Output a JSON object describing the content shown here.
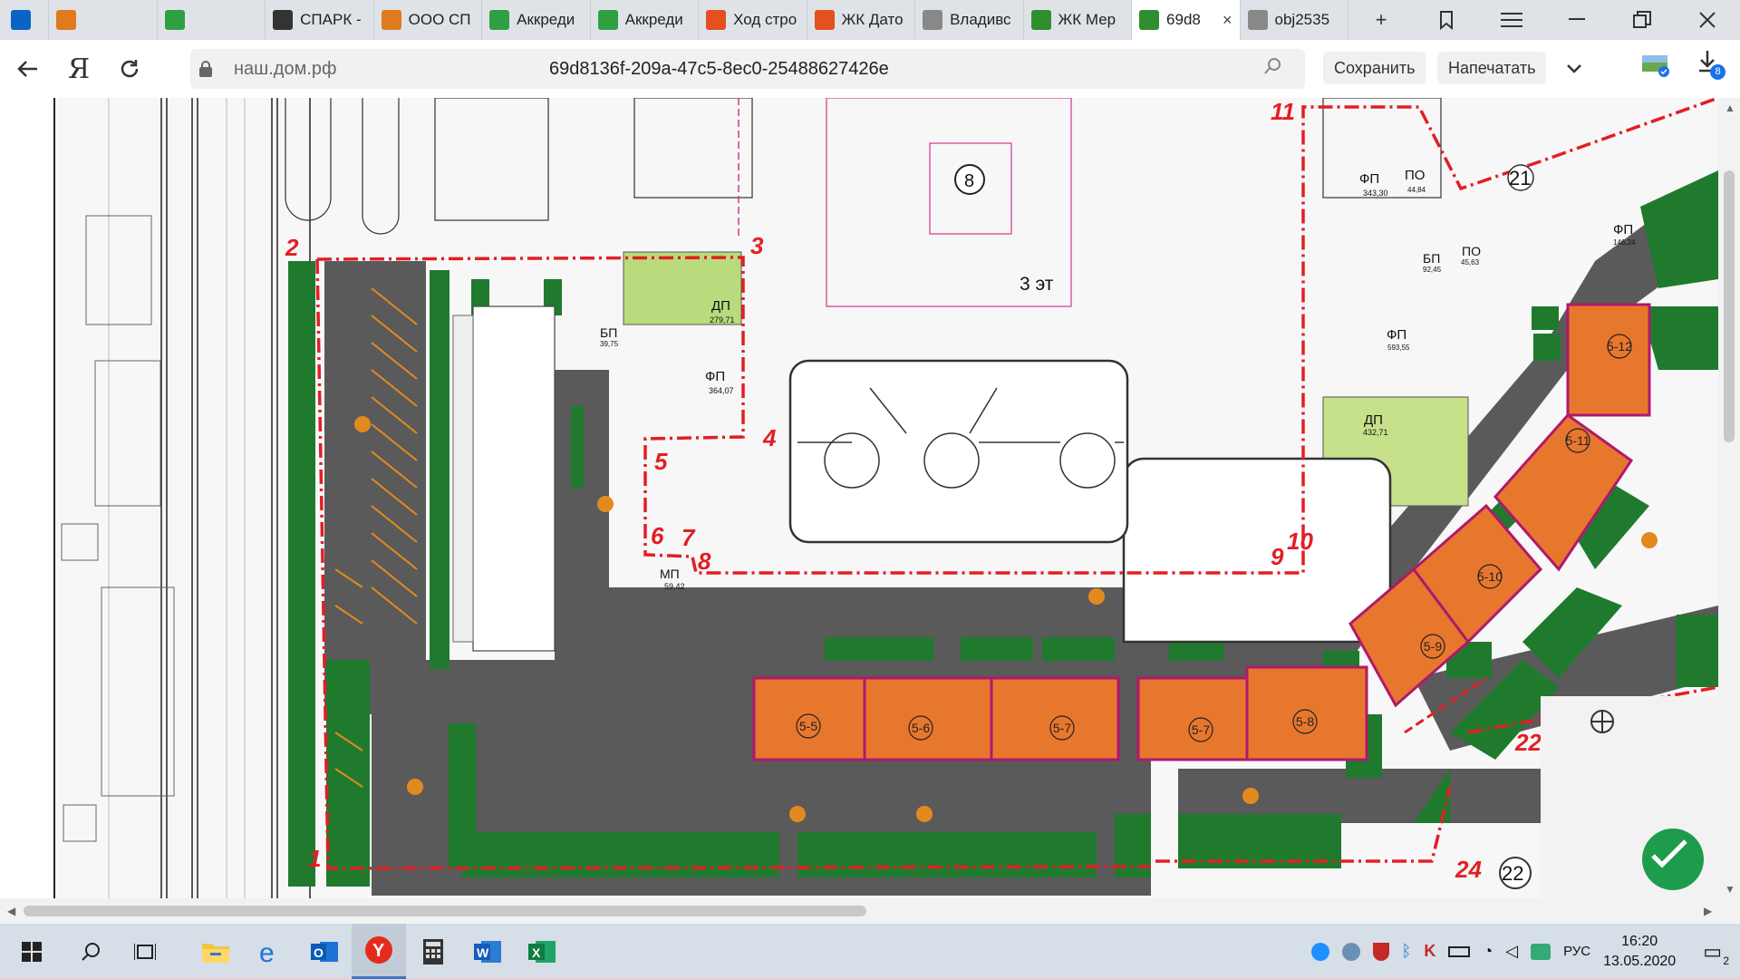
{
  "browser": {
    "tabs": [
      {
        "label": "",
        "icon": "outlook-icon",
        "color": "#0a64c6"
      },
      {
        "label": "",
        "icon": "task-icon",
        "color": "#e07a1f"
      },
      {
        "label": "",
        "icon": "green-logo-icon",
        "color": "#2ea043"
      },
      {
        "label": "СПАРК -",
        "icon": "spark-icon",
        "color": "#333333"
      },
      {
        "label": "ООО СП",
        "icon": "task-icon",
        "color": "#e07a1f"
      },
      {
        "label": "Аккреди",
        "icon": "green-logo-icon",
        "color": "#2ea043"
      },
      {
        "label": "Аккреди",
        "icon": "green-logo-icon",
        "color": "#2ea043"
      },
      {
        "label": "Ход стро",
        "icon": "swirl-icon",
        "color": "#e4501e"
      },
      {
        "label": "ЖК Дато",
        "icon": "swirl-icon",
        "color": "#e4501e"
      },
      {
        "label": "Владивс",
        "icon": "page-icon",
        "color": "#888888"
      },
      {
        "label": "ЖК Мер",
        "icon": "bars-icon",
        "color": "#2f8f2f"
      },
      {
        "label": "69d8",
        "icon": "bars-icon",
        "color": "#2f8f2f",
        "active": true
      },
      {
        "label": "obj2535",
        "icon": "page-icon",
        "color": "#888888"
      }
    ],
    "new_tab": "+",
    "address": {
      "domain": "наш.дом.рф",
      "path": "69d8136f-209a-47c5-8ec0-25488627426e"
    },
    "save_label": "Сохранить",
    "print_label": "Напечатать",
    "downloads_badge": "8"
  },
  "plan": {
    "points": [
      {
        "n": "1"
      },
      {
        "n": "2"
      },
      {
        "n": "3"
      },
      {
        "n": "4"
      },
      {
        "n": "5"
      },
      {
        "n": "6"
      },
      {
        "n": "7"
      },
      {
        "n": "8"
      },
      {
        "n": "9"
      },
      {
        "n": "10"
      },
      {
        "n": "11"
      },
      {
        "n": "21"
      },
      {
        "n": "22"
      },
      {
        "n": "24"
      }
    ],
    "labels": {
      "dp1": "ДП",
      "dp1_area": "279,71",
      "fp1": "ФП",
      "fp1_area": "364,07",
      "bp1": "БП",
      "bp1_area": "39,75",
      "mp": "МП",
      "mp_area": "59,42",
      "fp2": "ФП",
      "fp2_area": "343,30",
      "po1": "ПО",
      "po1_area": "44,84",
      "bp2": "БП",
      "bp2_area": "92,45",
      "po2": "ПО",
      "po2_area": "45,63",
      "fp3": "ФП",
      "fp3_area": "146,24",
      "fp4": "ФП",
      "fp4_area": "593,55",
      "dp2": "ДП",
      "dp2_area": "432,71",
      "floors": "3 эт",
      "bldg8": "8",
      "b22": "22"
    },
    "sections": [
      "5-5",
      "5-6",
      "5-7",
      "5-7",
      "5-8",
      "5-9",
      "5-10",
      "5-11",
      "5-12"
    ]
  },
  "taskbar": {
    "language": "РУС",
    "time": "16:20",
    "date": "13.05.2020",
    "notifications": "2"
  }
}
